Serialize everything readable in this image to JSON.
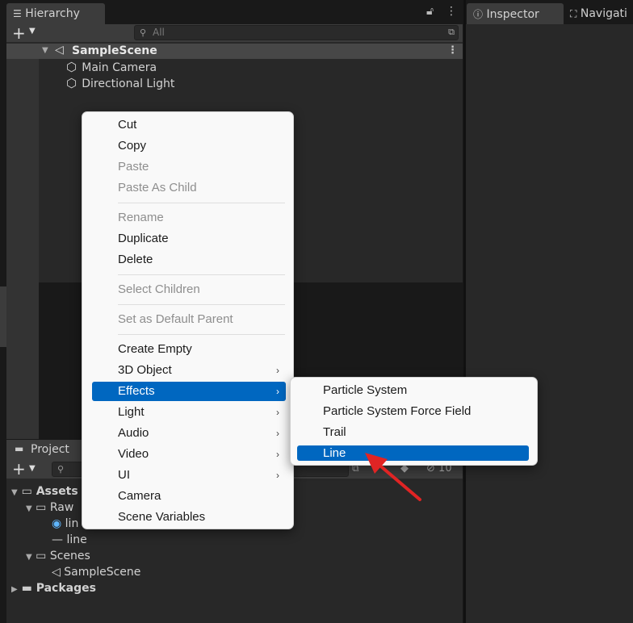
{
  "hierarchy": {
    "tab_label": "Hierarchy",
    "search_placeholder": "All",
    "scene_name": "SampleScene",
    "objects": [
      "Main Camera",
      "Directional Light"
    ]
  },
  "inspector": {
    "tab_label": "Inspector",
    "nav_tab_label": "Navigati"
  },
  "project": {
    "tab_label": "Project",
    "hidden_count": "10",
    "tree": {
      "assets": "Assets",
      "raw": "Raw",
      "raw_item_1": "lin",
      "raw_item_2": "line",
      "scenes": "Scenes",
      "scene_item": "SampleScene",
      "packages": "Packages"
    }
  },
  "context_menu": {
    "items": [
      {
        "label": "Cut"
      },
      {
        "label": "Copy"
      },
      {
        "label": "Paste"
      },
      {
        "label": "Paste As Child"
      },
      {
        "label": "Rename"
      },
      {
        "label": "Duplicate"
      },
      {
        "label": "Delete"
      },
      {
        "label": "Select Children"
      },
      {
        "label": "Set as Default Parent"
      },
      {
        "label": "Create Empty"
      },
      {
        "label": "3D Object"
      },
      {
        "label": "Effects"
      },
      {
        "label": "Light"
      },
      {
        "label": "Audio"
      },
      {
        "label": "Video"
      },
      {
        "label": "UI"
      },
      {
        "label": "Camera"
      },
      {
        "label": "Scene Variables"
      }
    ]
  },
  "submenu": {
    "items": [
      {
        "label": "Particle System"
      },
      {
        "label": "Particle System Force Field"
      },
      {
        "label": "Trail"
      },
      {
        "label": "Line"
      }
    ]
  },
  "colors": {
    "selection": "#0067c0",
    "annotation_arrow": "#e02424"
  }
}
